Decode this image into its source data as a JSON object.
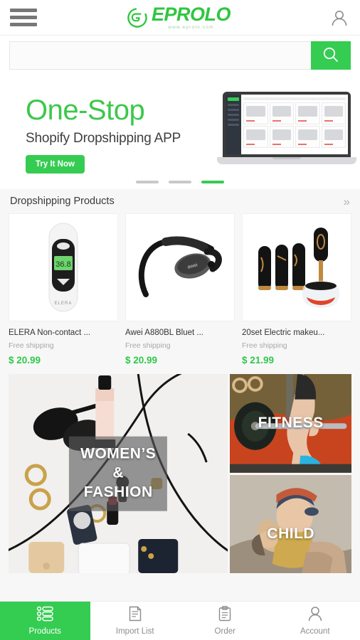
{
  "header": {
    "menu_icon": "hamburger-menu-icon",
    "logo_text": "EPROLO",
    "logo_subtitle": "www.eprolo.com",
    "account_icon": "user-account-icon"
  },
  "search": {
    "value": "",
    "placeholder": "",
    "button_icon": "search-icon"
  },
  "banner": {
    "headline": "One-Stop",
    "subhead": "Shopify Dropshipping APP",
    "cta_label": "Try It Now",
    "image": "laptop-dashboard-mockup",
    "dots": [
      {
        "active": false
      },
      {
        "active": false
      },
      {
        "active": true
      }
    ]
  },
  "section": {
    "title": "Dropshipping Products",
    "more_icon": "double-chevron-right-icon",
    "more_label": "»"
  },
  "products": [
    {
      "title": "ELERA Non-contact ...",
      "shipping": "Free shipping",
      "price": "$ 20.99",
      "image": "infrared-forehead-thermometer"
    },
    {
      "title": "Awei A880BL Bluet ...",
      "shipping": "Free shipping",
      "price": "$ 20.99",
      "image": "bluetooth-neckband-earphones"
    },
    {
      "title": "20set Electric makeu...",
      "shipping": "Free shipping",
      "price": "$ 21.99",
      "image": "electric-makeup-brush-set"
    }
  ],
  "categories": [
    {
      "label": "WOMEN’S\n&\nFASHION",
      "image": "womens-fashion-flatlay"
    },
    {
      "label": "FITNESS",
      "image": "barbell-gym-athlete"
    },
    {
      "label": "CHILD",
      "image": "parent-holding-baby"
    }
  ],
  "tabbar": [
    {
      "label": "Products",
      "icon": "product-list-icon",
      "active": true
    },
    {
      "label": "Import List",
      "icon": "document-icon",
      "active": false
    },
    {
      "label": "Order",
      "icon": "clipboard-icon",
      "active": false
    },
    {
      "label": "Account",
      "icon": "person-icon",
      "active": false
    }
  ],
  "colors": {
    "brand_green": "#35cc52",
    "price_green": "#2ec94a",
    "headline_green": "#3cc84b",
    "page_bg": "#f7f7f7",
    "muted_text": "#a8a8a8"
  }
}
